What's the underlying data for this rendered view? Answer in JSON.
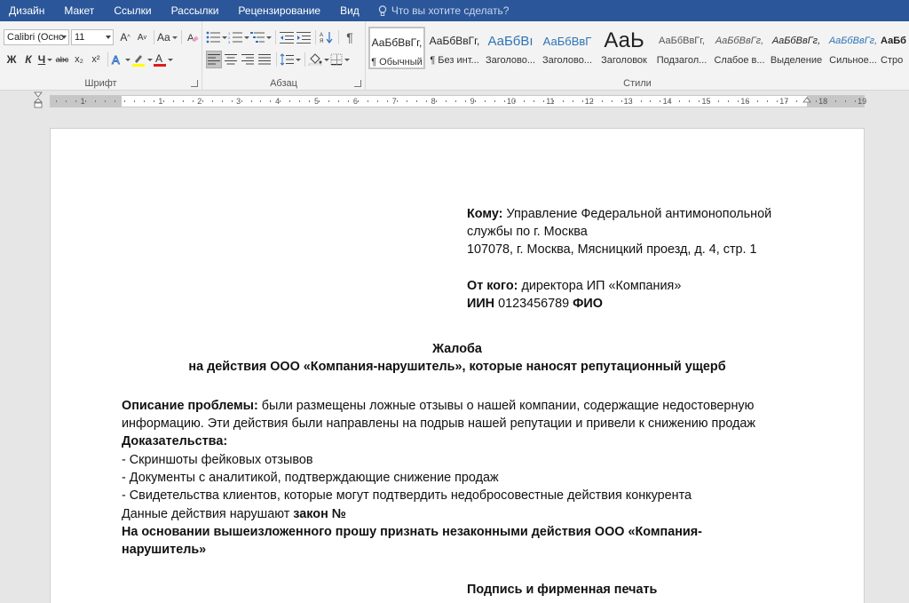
{
  "menu": {
    "tabs": [
      "Дизайн",
      "Макет",
      "Ссылки",
      "Рассылки",
      "Рецензирование",
      "Вид"
    ],
    "tell_me": "Что вы хотите сделать?"
  },
  "ribbon": {
    "font": {
      "label": "Шрифт",
      "name": "Calibri (Оснс",
      "size": "11",
      "grow": "A",
      "shrink": "A",
      "case": "Aa",
      "bold": "Ж",
      "italic": "К",
      "underline": "Ч",
      "strike": "abc",
      "sub": "x₂",
      "sup": "x²"
    },
    "paragraph": {
      "label": "Абзац"
    },
    "styles": {
      "label": "Стили",
      "items": [
        {
          "preview": "АаБбВвГг,",
          "name": "¶ Обычный"
        },
        {
          "preview": "АаБбВвГг,",
          "name": "¶ Без инт..."
        },
        {
          "preview": "АаБбВı",
          "name": "Заголово..."
        },
        {
          "preview": "АаБбВвГ",
          "name": "Заголово..."
        },
        {
          "preview": "АаЬ",
          "name": "Заголовок"
        },
        {
          "preview": "АаБбВвГг,",
          "name": "Подзагол..."
        },
        {
          "preview": "АаБбВвГг,",
          "name": "Слабое в..."
        },
        {
          "preview": "АаБбВвГг,",
          "name": "Выделение"
        },
        {
          "preview": "АаБбВвГг,",
          "name": "Сильное..."
        },
        {
          "preview": "АаБб",
          "name": "Стро"
        }
      ]
    }
  },
  "ruler": {
    "labels": [
      "1",
      "1",
      "2",
      "3",
      "4",
      "5",
      "6",
      "7",
      "8",
      "9",
      "10",
      "11",
      "12",
      "13",
      "14",
      "15",
      "16",
      "17",
      "18",
      "19"
    ]
  },
  "document": {
    "to_label": "Кому:",
    "to_text": "Управление Федеральной антимонопольной",
    "to_line2": "службы по г. Москва",
    "to_line3": "107078, г. Москва, Мясницкий проезд, д. 4, стр. 1",
    "from_label": "От кого:",
    "from_text": "директора ИП «Компания»",
    "inn_label": "ИИН",
    "inn_value": "0123456789",
    "fio": "ФИО",
    "title": "Жалоба",
    "subtitle": "на действия ООО «Компания-нарушитель», которые наносят репутационный ущерб",
    "problem_label": "Описание проблемы:",
    "problem_text": "были размещены ложные отзывы о нашей компании, содержащие недостоверную",
    "problem_line2": "информацию. Эти действия были направлены на подрыв нашей репутации и привели к снижению продаж",
    "evidence_label": "Доказательства:",
    "evidence_items": [
      "- Скриншоты фейковых отзывов",
      "- Документы с аналитикой, подтверждающие снижение продаж",
      "- Свидетельства клиентов, которые могут подтвердить недобросовестные действия конкурента"
    ],
    "law_text": "Данные действия нарушают",
    "law_bold": "закон №",
    "request_line1": "На основании вышеизложенного прошу признать незаконными действия ООО «Компания-",
    "request_line2": "нарушитель»",
    "signature": "Подпись и фирменная печать"
  }
}
